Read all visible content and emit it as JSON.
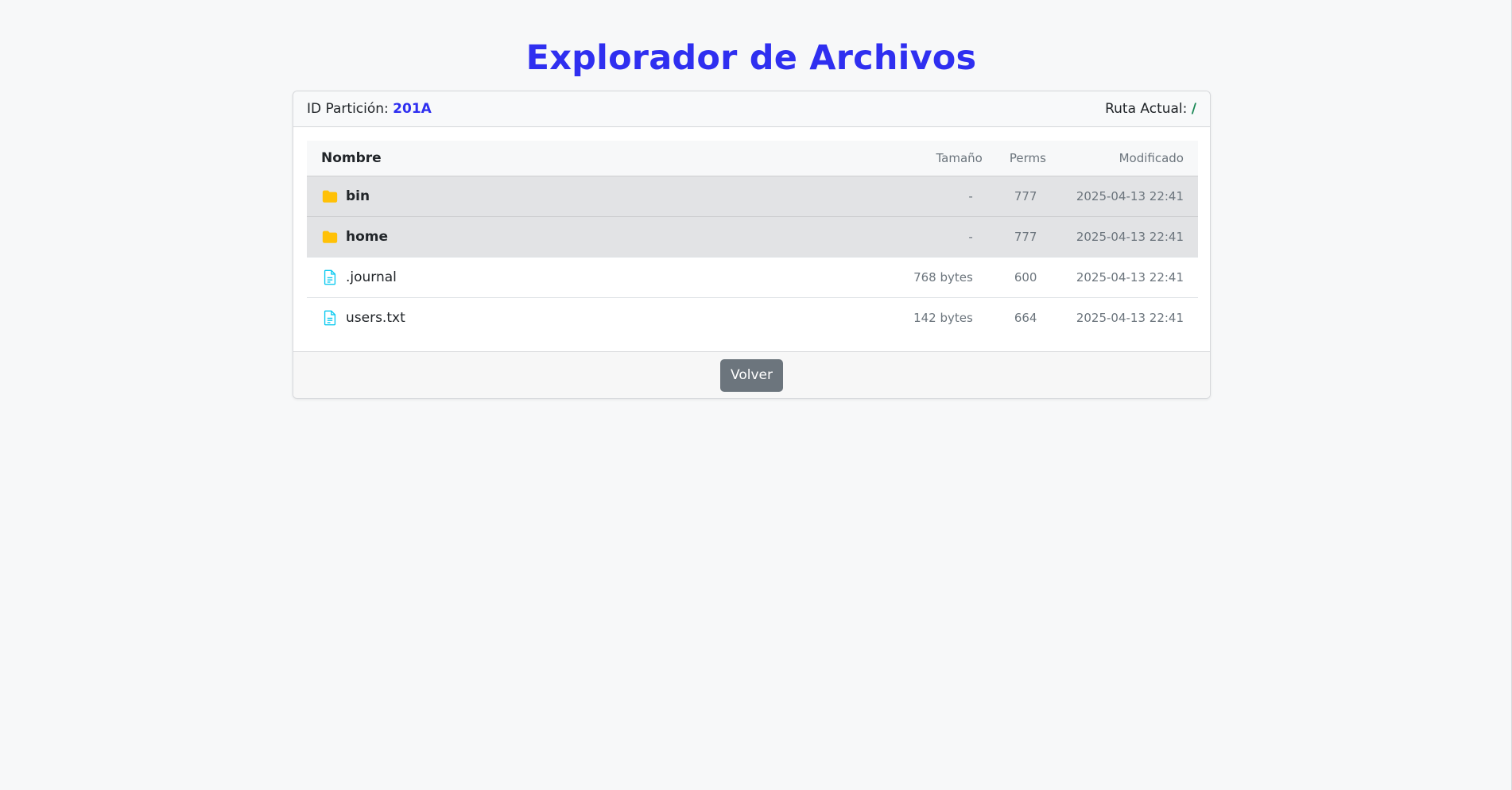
{
  "title": "Explorador de Archivos",
  "header": {
    "partition_label": "ID Partición:",
    "partition_id": "201A",
    "path_label": "Ruta Actual:",
    "path_value": "/"
  },
  "table": {
    "columns": {
      "name": "Nombre",
      "size": "Tamaño",
      "perms": "Perms",
      "modified": "Modificado"
    },
    "rows": [
      {
        "type": "folder",
        "icon": "folder-icon",
        "name": "bin",
        "size": "-",
        "perms": "777",
        "modified": "2025-04-13 22:41"
      },
      {
        "type": "folder",
        "icon": "folder-icon",
        "name": "home",
        "size": "-",
        "perms": "777",
        "modified": "2025-04-13 22:41"
      },
      {
        "type": "file",
        "icon": "file-text-icon",
        "name": ".journal",
        "size": "768 bytes",
        "perms": "600",
        "modified": "2025-04-13 22:41"
      },
      {
        "type": "file",
        "icon": "file-text-icon",
        "name": "users.txt",
        "size": "142 bytes",
        "perms": "664",
        "modified": "2025-04-13 22:41"
      }
    ]
  },
  "footer": {
    "back_label": "Volver"
  },
  "colors": {
    "title": "#2f2ff0",
    "partition_id": "#2f2ff0",
    "path_value": "#198754",
    "folder_icon": "#ffc107",
    "file_icon": "#0dcaf0",
    "back_button": "#6c757d"
  }
}
